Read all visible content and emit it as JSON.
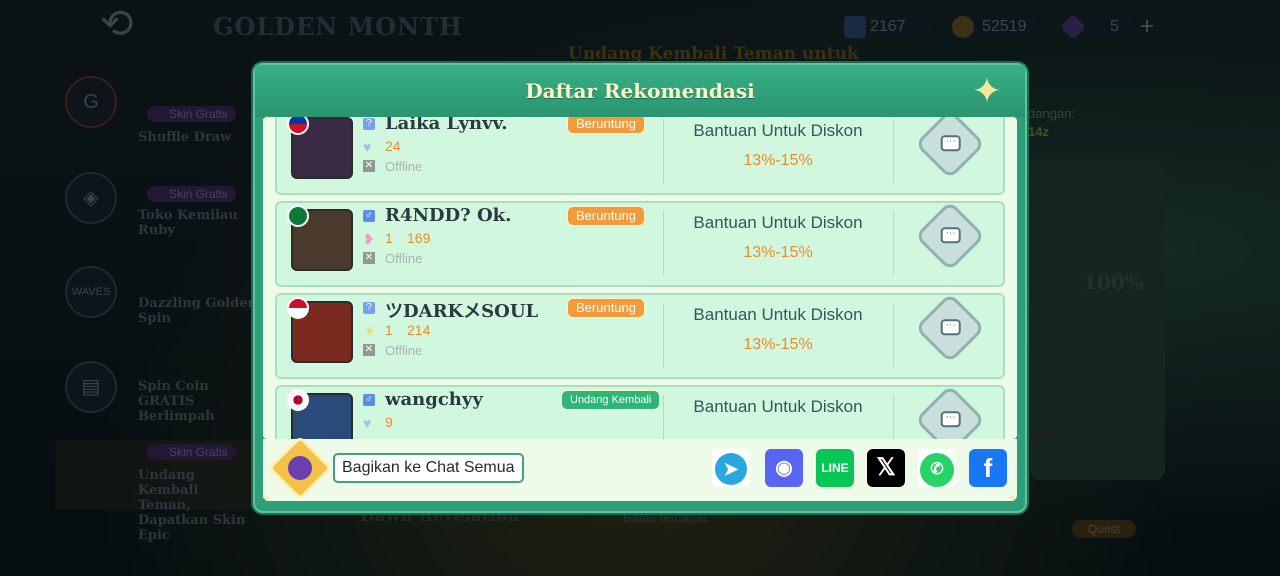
{
  "game": {
    "title": "GOLDEN MONTH"
  },
  "currency": [
    {
      "icon": "diamond-ticket-icon",
      "value": "2167"
    },
    {
      "icon": "battle-points-icon",
      "value": "52519"
    },
    {
      "icon": "diamond-icon",
      "value": "5"
    }
  ],
  "sidebar": {
    "items": [
      {
        "label": "Shuffle Draw",
        "badge": "Skin Gratis"
      },
      {
        "label": "Toko Kemilau Ruby",
        "badge": "Skin Gratis"
      },
      {
        "label": "Dazzling Golden Spin",
        "badge": ""
      },
      {
        "label": "Spin Coin GRATIS Berlimpah",
        "badge": ""
      },
      {
        "label": "Undang Kembali Teman, Dapatkan Skin Epic",
        "badge": "Skin Gratis"
      }
    ]
  },
  "background": {
    "subtitle": "Undang Kembali Teman untuk",
    "invite_partial": "dangan:",
    "invite_count_partial": "14z",
    "progress": "100%",
    "claim_partial": "nan",
    "event_name": "Dawn Revelation",
    "limit_text": "Batas tercapai.",
    "quest_label": "Quest"
  },
  "modal": {
    "title": "Daftar Rekomendasi",
    "rows": [
      {
        "name": "Laika Lynvv.",
        "tag": "Beruntung",
        "tag_style": "orange",
        "level_prefix": "",
        "level": "24",
        "status": "Offline",
        "help": "Bantuan Untuk Diskon",
        "discount": "13%-15%"
      },
      {
        "name": "R4NDD? Ok.",
        "tag": "Beruntung",
        "tag_style": "orange",
        "level_prefix": "1",
        "level": "169",
        "status": "Offline",
        "help": "Bantuan Untuk Diskon",
        "discount": "13%-15%"
      },
      {
        "name": "ツDARKメSOUL",
        "tag": "Beruntung",
        "tag_style": "orange",
        "level_prefix": "1",
        "level": "214",
        "status": "Offline",
        "help": "Bantuan Untuk Diskon",
        "discount": "13%-15%"
      },
      {
        "name": "wangchyy",
        "tag": "Undang Kembali",
        "tag_style": "green",
        "level_prefix": "",
        "level": "9",
        "status": "",
        "help": "Bantuan Untuk Diskon",
        "discount": ""
      }
    ],
    "share_label": "Bagikan ke Chat Semua",
    "social": [
      "Telegram",
      "Discord",
      "LINE",
      "X",
      "WhatsApp",
      "Facebook"
    ]
  },
  "colors": {
    "modal": "#2f9e7a",
    "row": "#d2f7df",
    "tag": "#f39a3d",
    "discount": "#ef8b2a"
  }
}
